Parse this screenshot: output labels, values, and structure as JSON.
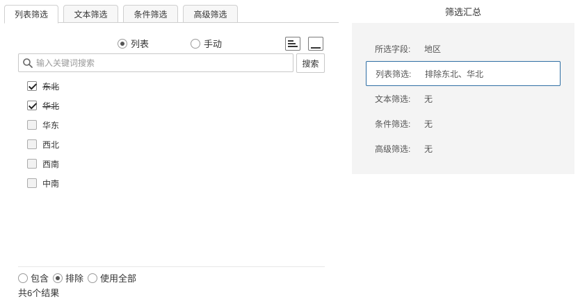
{
  "tabs": [
    {
      "label": "列表筛选",
      "active": true
    },
    {
      "label": "文本筛选",
      "active": false
    },
    {
      "label": "条件筛选",
      "active": false
    },
    {
      "label": "高级筛选",
      "active": false
    }
  ],
  "view_mode": {
    "options": [
      {
        "label": "列表",
        "checked": true
      },
      {
        "label": "手动",
        "checked": false
      }
    ]
  },
  "search": {
    "placeholder": "输入关键词搜索",
    "button_label": "搜索"
  },
  "items": [
    {
      "label": "东北",
      "checked": true
    },
    {
      "label": "华北",
      "checked": true
    },
    {
      "label": "华东",
      "checked": false
    },
    {
      "label": "西北",
      "checked": false
    },
    {
      "label": "西南",
      "checked": false
    },
    {
      "label": "中南",
      "checked": false
    }
  ],
  "filter_mode": {
    "options": [
      {
        "label": "包含",
        "checked": false
      },
      {
        "label": "排除",
        "checked": true
      },
      {
        "label": "使用全部",
        "checked": false
      }
    ]
  },
  "result_count": "共6个结果",
  "summary": {
    "title": "筛选汇总",
    "rows": [
      {
        "key": "所选字段:",
        "value": "地区",
        "selected": false
      },
      {
        "key": "列表筛选:",
        "value": "排除东北、华北",
        "selected": true
      },
      {
        "key": "文本筛选:",
        "value": "无",
        "selected": false
      },
      {
        "key": "条件筛选:",
        "value": "无",
        "selected": false
      },
      {
        "key": "高级筛选:",
        "value": "无",
        "selected": false
      }
    ]
  },
  "colors": {
    "accent_border": "#2d6da3",
    "panel_bg": "#f4f4f4"
  }
}
